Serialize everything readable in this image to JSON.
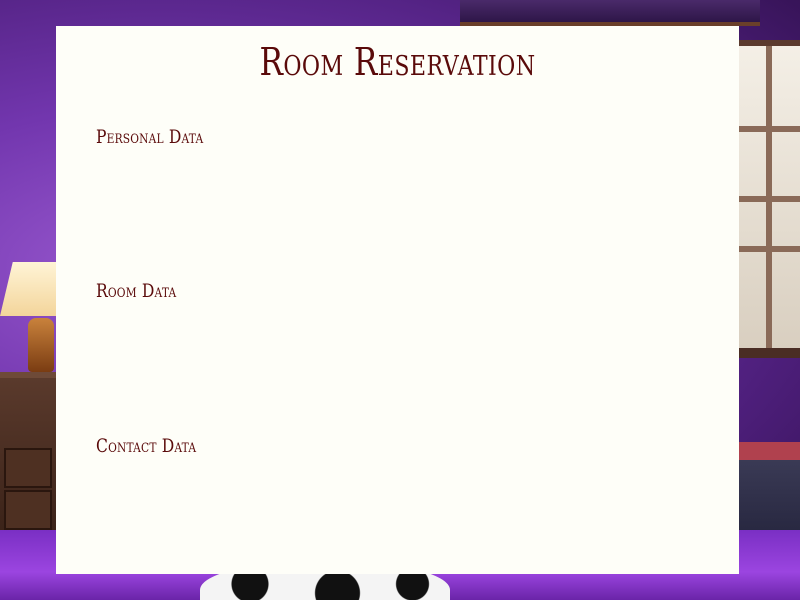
{
  "page": {
    "title": "Room Reservation"
  },
  "sections": [
    {
      "label": "Personal Data"
    },
    {
      "label": "Room Data"
    },
    {
      "label": "Contact Data"
    }
  ],
  "colors": {
    "heading_text": "#5a0a0a",
    "card_background": "#fefef8",
    "scene_background": "#6a2fa0"
  }
}
